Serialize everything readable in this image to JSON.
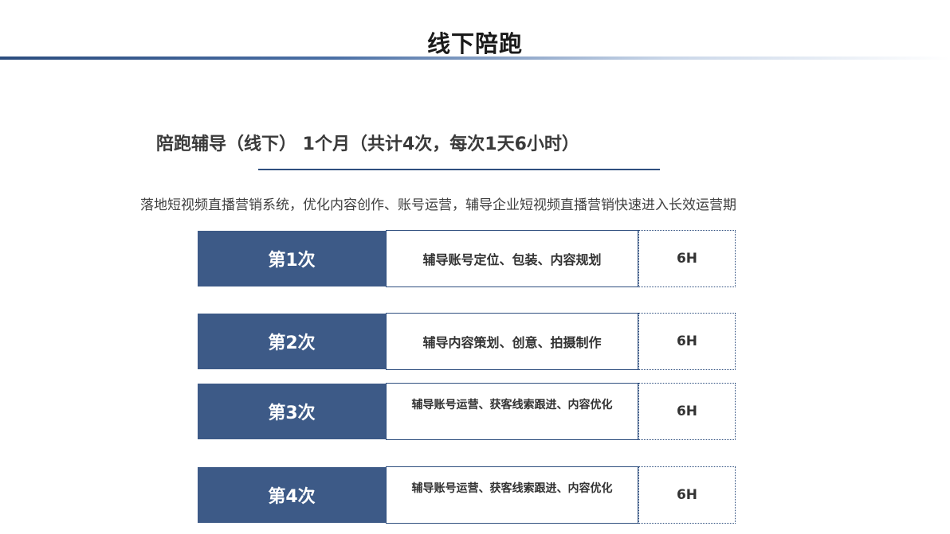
{
  "header": {
    "title": "线下陪跑"
  },
  "program": {
    "subtitle": "陪跑辅导（线下）  1个月（共计4次，每次1天6小时）",
    "description": "落地短视频直播营销系统，优化内容创作、账号运营，辅导企业短视频直播营销快速进入长效运营期"
  },
  "sessions": [
    {
      "label": "第1次",
      "content": "辅导账号定位、包装、内容规划",
      "hours": "6H"
    },
    {
      "label": "第2次",
      "content": "辅导内容策划、创意、拍摄制作",
      "hours": "6H"
    },
    {
      "label": "第3次",
      "content": "辅导账号运营、获客线索跟进、内容优化",
      "hours": "6H"
    },
    {
      "label": "第4次",
      "content": "辅导账号运营、获客线索跟进、内容优化",
      "hours": "6H"
    }
  ],
  "colors": {
    "accent": "#3d5a87",
    "rule": "#2f4f7f"
  }
}
